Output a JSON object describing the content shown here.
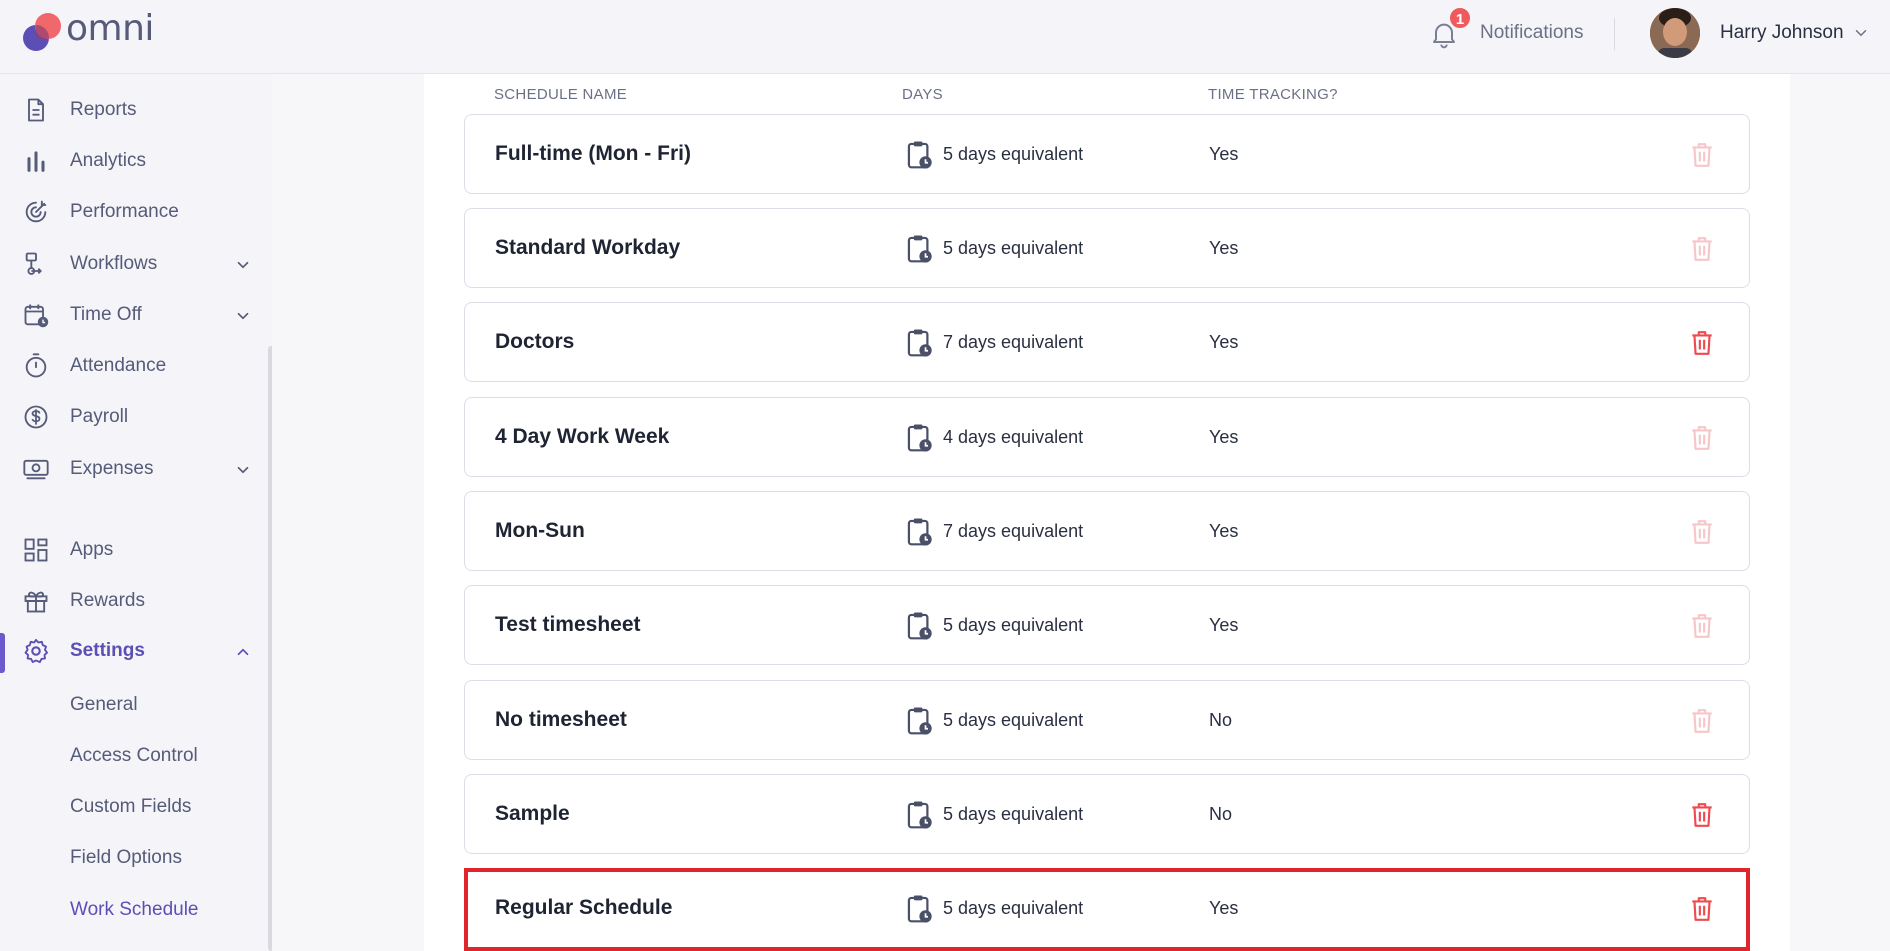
{
  "app": {
    "logo_text": "omni"
  },
  "header": {
    "notifications_label": "Notifications",
    "notifications_count": "1",
    "user_name": "Harry Johnson"
  },
  "sidebar": {
    "items": [
      {
        "label": "Reports",
        "icon": "report-icon"
      },
      {
        "label": "Analytics",
        "icon": "bar-chart-icon"
      },
      {
        "label": "Performance",
        "icon": "performance-icon"
      },
      {
        "label": "Workflows",
        "icon": "workflow-icon"
      },
      {
        "label": "Time Off",
        "icon": "calendar-clock-icon"
      },
      {
        "label": "Attendance",
        "icon": "stopwatch-icon"
      },
      {
        "label": "Payroll",
        "icon": "dollar-icon"
      },
      {
        "label": "Expenses",
        "icon": "money-icon"
      },
      {
        "label": "Apps",
        "icon": "apps-grid-icon"
      },
      {
        "label": "Rewards",
        "icon": "gift-icon"
      },
      {
        "label": "Settings",
        "icon": "gear-icon"
      }
    ],
    "settings_sub": [
      "General",
      "Access Control",
      "Custom Fields",
      "Field Options",
      "Work Schedule"
    ]
  },
  "table": {
    "headers": {
      "name": "SCHEDULE NAME",
      "days": "DAYS",
      "time_tracking": "TIME TRACKING?"
    },
    "rows": [
      {
        "name": "Full-time (Mon - Fri)",
        "days": "5 days equivalent",
        "time_tracking": "Yes",
        "deletable": false
      },
      {
        "name": "Standard Workday",
        "days": "5 days equivalent",
        "time_tracking": "Yes",
        "deletable": false
      },
      {
        "name": "Doctors",
        "days": "7 days equivalent",
        "time_tracking": "Yes",
        "deletable": true
      },
      {
        "name": "4 Day Work Week",
        "days": "4 days equivalent",
        "time_tracking": "Yes",
        "deletable": false
      },
      {
        "name": "Mon-Sun",
        "days": "7 days equivalent",
        "time_tracking": "Yes",
        "deletable": false
      },
      {
        "name": "Test timesheet",
        "days": "5 days equivalent",
        "time_tracking": "Yes",
        "deletable": false
      },
      {
        "name": "No timesheet",
        "days": "5 days equivalent",
        "time_tracking": "No",
        "deletable": false
      },
      {
        "name": "Sample",
        "days": "5 days equivalent",
        "time_tracking": "No",
        "deletable": true
      },
      {
        "name": "Regular Schedule",
        "days": "5 days equivalent",
        "time_tracking": "Yes",
        "deletable": true
      }
    ]
  },
  "colors": {
    "accent": "#5b4fb5",
    "trash_active": "#ef4a4f",
    "trash_disabled": "#f7c6c8",
    "highlight": "#e0262b"
  }
}
